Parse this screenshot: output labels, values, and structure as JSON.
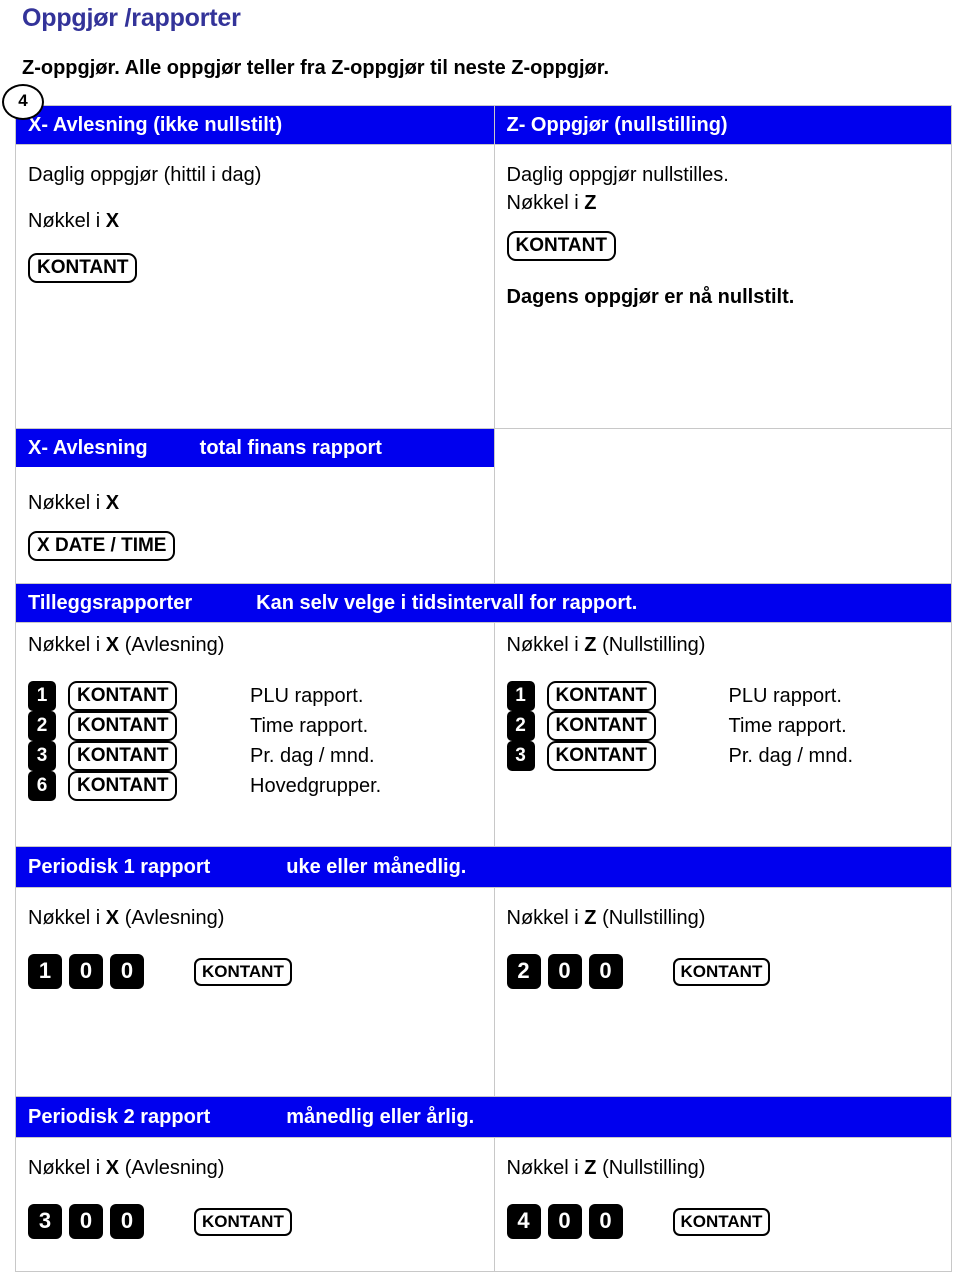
{
  "document": {
    "title": "Oppgjør /rapporter",
    "intro": "Z-oppgjør. Alle oppgjør teller fra Z-oppgjør til neste Z-oppgjør.",
    "page_badge": "4",
    "title_color": "#333399",
    "bar_color": "#0000EE"
  },
  "headers": {
    "left": "X- Avlesning (ikke nullstilt)",
    "right": "Z- Oppgjør (nullstilling)"
  },
  "daily": {
    "left": {
      "line1": "Daglig oppgjør (hittil i dag)",
      "line2_prefix": "Nøkkel i ",
      "line2_key": "X",
      "kontant": "KONTANT"
    },
    "right": {
      "line1": "Daglig oppgjør nullstilles.",
      "line2_prefix": "Nøkkel i ",
      "line2_key": "Z",
      "kontant": "KONTANT",
      "result": "Dagens oppgjør er nå nullstilt."
    }
  },
  "finance_bar": {
    "label": "X- Avlesning",
    "desc": "total finans rapport"
  },
  "datetime": {
    "line1_prefix": "Nøkkel i ",
    "line1_key": "X",
    "key_button": "X DATE / TIME"
  },
  "extra_bar": {
    "label": "Tilleggsrapporter",
    "desc": "Kan selv velge i tidsintervall for rapport."
  },
  "extra": {
    "left": {
      "key_line_prefix": "Nøkkel i ",
      "key_line_key": "X",
      "key_line_suffix": " (Avlesning)",
      "rows": [
        {
          "num": "1",
          "kontant": "KONTANT",
          "desc": "PLU rapport."
        },
        {
          "num": "2",
          "kontant": "KONTANT",
          "desc": "Time rapport."
        },
        {
          "num": "3",
          "kontant": "KONTANT",
          "desc": "Pr. dag / mnd."
        },
        {
          "num": "6",
          "kontant": "KONTANT",
          "desc": "Hovedgrupper."
        }
      ]
    },
    "right": {
      "key_line_prefix": "Nøkkel i ",
      "key_line_key": "Z",
      "key_line_suffix": " (Nullstilling)",
      "rows": [
        {
          "num": "1",
          "kontant": "KONTANT",
          "desc": "PLU rapport."
        },
        {
          "num": "2",
          "kontant": "KONTANT",
          "desc": "Time rapport."
        },
        {
          "num": "3",
          "kontant": "KONTANT",
          "desc": "Pr. dag / mnd."
        }
      ]
    }
  },
  "periodisk1": {
    "bar_label": "Periodisk 1 rapport",
    "bar_desc": "uke eller månedlig.",
    "left": {
      "key_line_prefix": "Nøkkel i ",
      "key_line_key": "X",
      "key_line_suffix": " (Avlesning)",
      "digits": [
        "1",
        "0",
        "0"
      ],
      "kontant": "KONTANT"
    },
    "right": {
      "key_line_prefix": "Nøkkel i ",
      "key_line_key": "Z",
      "key_line_suffix": " (Nullstilling)",
      "digits": [
        "2",
        "0",
        "0"
      ],
      "kontant": "KONTANT"
    }
  },
  "periodisk2": {
    "bar_label": "Periodisk 2 rapport",
    "bar_desc": "månedlig eller årlig.",
    "left": {
      "key_line_prefix": "Nøkkel i ",
      "key_line_key": "X",
      "key_line_suffix": " (Avlesning)",
      "digits": [
        "3",
        "0",
        "0"
      ],
      "kontant": "KONTANT"
    },
    "right": {
      "key_line_prefix": "Nøkkel i ",
      "key_line_key": "Z",
      "key_line_suffix": " (Nullstilling)",
      "digits": [
        "4",
        "0",
        "0"
      ],
      "kontant": "KONTANT"
    }
  }
}
